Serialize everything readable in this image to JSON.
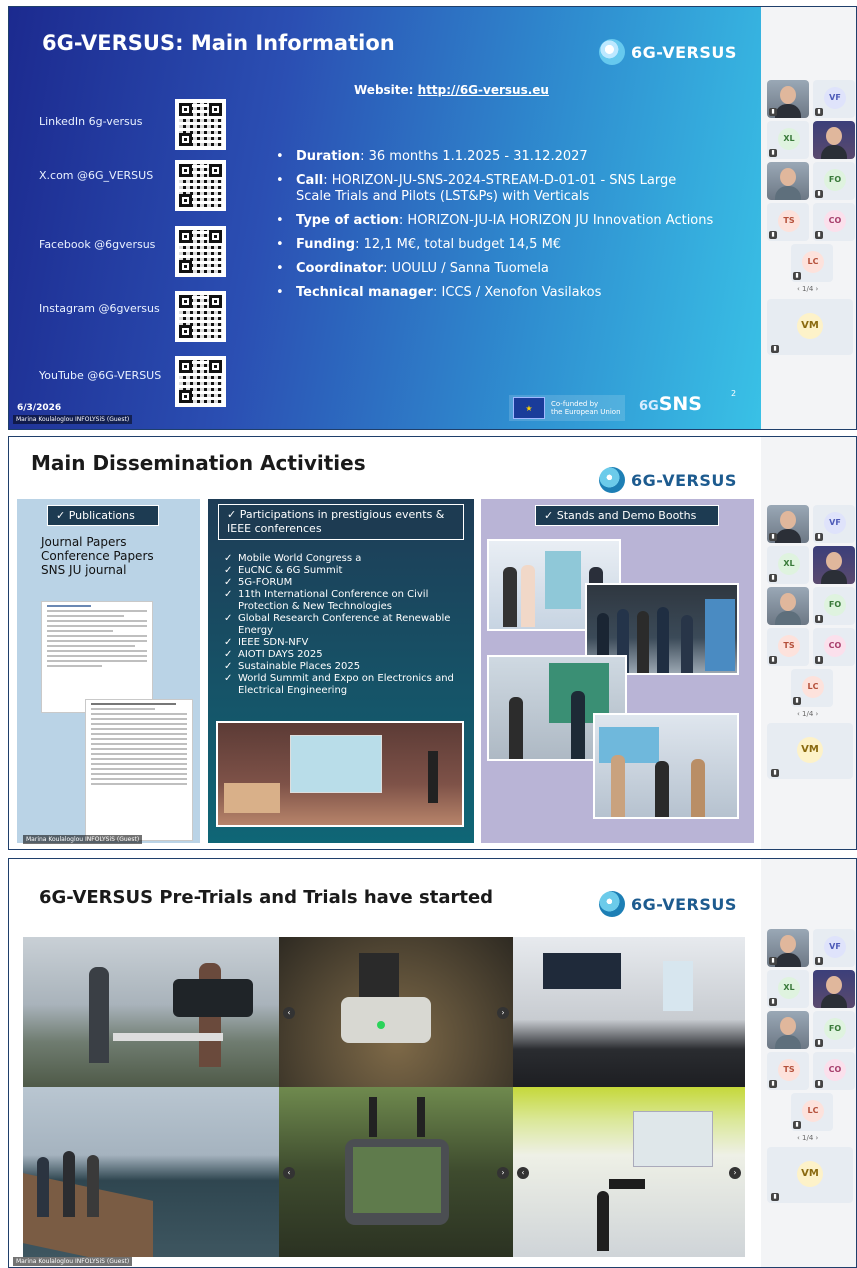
{
  "slide1": {
    "title": "6G-VERSUS: Main Information",
    "logo": "6G-VERSUS",
    "website_label": "Website:",
    "website_url": "http://6G-versus.eu",
    "socials": [
      {
        "label": "LinkedIn 6g-versus"
      },
      {
        "label": "X.com @6G_VERSUS"
      },
      {
        "label": "Facebook @6gversus"
      },
      {
        "label": "Instagram @6gversus"
      },
      {
        "label": "YouTube @6G-VERSUS"
      }
    ],
    "bullets": [
      {
        "key": "Duration",
        "value": ": 36 months 1.1.2025 - 31.12.2027"
      },
      {
        "key": "Call",
        "value": ": HORIZON-JU-SNS-2024-STREAM-D-01-01 - SNS Large Scale Trials and Pilots (LST&Ps) with Verticals"
      },
      {
        "key": "Type of action",
        "value": ": HORIZON-JU-IA HORIZON JU Innovation Actions"
      },
      {
        "key": "Funding",
        "value": ": 12,1 M€, total budget 14,5 M€"
      },
      {
        "key": "Coordinator",
        "value": ": UOULU / Sanna Tuomela"
      },
      {
        "key": "Technical manager",
        "value": ": ICCS / Xenofon Vasilakos"
      }
    ],
    "date": "6/3/2026",
    "guest": "Marina Koulaloglou INFOLYSiS (Guest)",
    "eu_text_1": "Co-funded by",
    "eu_text_2": "the European Union",
    "sns": "SNS",
    "sns_prefix": "6G",
    "slide_number": "2"
  },
  "slide2": {
    "title": "Main Dissemination Activities",
    "logo": "6G-VERSUS",
    "publications_head": "✓  Publications",
    "publications": [
      "Journal Papers",
      "Conference Papers",
      "SNS JU journal"
    ],
    "events_head": "✓  Participations in prestigious events & IEEE conferences",
    "events": [
      "Mobile World Congress a",
      "EuCNC & 6G Summit",
      "5G-FORUM",
      "11th International Conference on Civil Protection & New Technologies",
      "Global Research Conference at Renewable Energy",
      "IEEE SDN-NFV",
      "AIOTI DAYS 2025",
      "Sustainable Places 2025",
      "World Summit and Expo on Electronics and Electrical Engineering"
    ],
    "stands_head": "✓  Stands and Demo Booths",
    "guest": "Marina Koulaloglou INFOLYSiS (Guest)"
  },
  "slide3": {
    "title": "6G-VERSUS Pre-Trials and Trials have started",
    "logo": "6G-VERSUS",
    "guest": "Marina Koulaloglou INFOLYSiS (Guest)"
  },
  "participants": {
    "initials": [
      "VF",
      "XL",
      "FO",
      "TS",
      "CO",
      "LC"
    ],
    "pager": "‹  1/4  ›",
    "main": "VM"
  },
  "colors": {
    "vf": "#dfe3fb",
    "xl": "#dff3df",
    "fo": "#dff3df",
    "ts": "#fde2dc",
    "co": "#fbe0ec",
    "lc": "#fde2dc",
    "vm": "#fdf2c9"
  }
}
